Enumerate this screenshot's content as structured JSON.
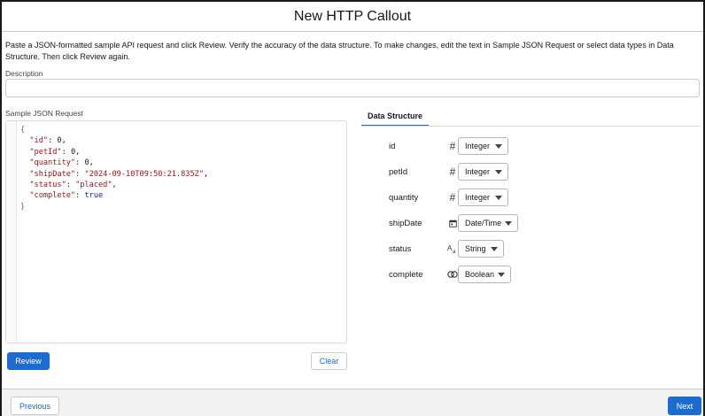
{
  "header": {
    "title": "New HTTP Callout"
  },
  "instructions": "Paste a JSON-formatted sample API request and click Review. Verify the accuracy of the data structure. To make changes, edit the text in Sample JSON Request or select data types in Data Structure. Then click Review again.",
  "description": {
    "label": "Description",
    "value": ""
  },
  "sample_json": {
    "label": "Sample JSON Request",
    "open_brace": "{",
    "close_brace": "}",
    "lines": [
      {
        "key": "\"id\"",
        "value": "0",
        "type": "num",
        "comma": ","
      },
      {
        "key": "\"petId\"",
        "value": "0",
        "type": "num",
        "comma": ","
      },
      {
        "key": "\"quantity\"",
        "value": "0",
        "type": "num",
        "comma": ","
      },
      {
        "key": "\"shipDate\"",
        "value": "\"2024-09-10T09:50:21.835Z\"",
        "type": "str",
        "comma": ","
      },
      {
        "key": "\"status\"",
        "value": "\"placed\"",
        "type": "str",
        "comma": ","
      },
      {
        "key": "\"complete\"",
        "value": "true",
        "type": "bool",
        "comma": ""
      }
    ]
  },
  "buttons": {
    "review": "Review",
    "clear": "Clear",
    "previous": "Previous",
    "next": "Next"
  },
  "data_structure": {
    "tab_label": "Data Structure",
    "fields": [
      {
        "name": "id",
        "icon": "number-icon",
        "glyph": "#",
        "type": "Integer"
      },
      {
        "name": "petId",
        "icon": "number-icon",
        "glyph": "#",
        "type": "Integer"
      },
      {
        "name": "quantity",
        "icon": "number-icon",
        "glyph": "#",
        "type": "Integer"
      },
      {
        "name": "shipDate",
        "icon": "calendar-icon",
        "glyph": "",
        "type": "Date/Time"
      },
      {
        "name": "status",
        "icon": "text-icon",
        "glyph": "",
        "type": "String"
      },
      {
        "name": "complete",
        "icon": "boolean-icon",
        "glyph": "",
        "type": "Boolean"
      }
    ]
  },
  "colors": {
    "brand": "#1b6bd0",
    "json_key": "#a31515",
    "json_brace": "#2c9a2c",
    "json_bool": "#1c1ca8"
  }
}
